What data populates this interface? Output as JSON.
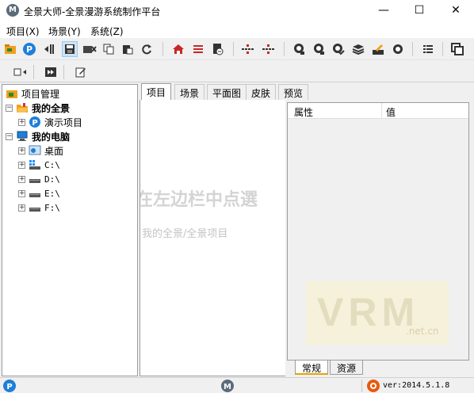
{
  "window": {
    "title": "全景大师-全景漫游系统制作平台",
    "app_icon_letter": "M",
    "controls": {
      "minimize": "—",
      "maximize": "☐",
      "close": "✕"
    }
  },
  "menu": {
    "items": [
      "项目(X)",
      "场景(Y)",
      "系统(Z)"
    ]
  },
  "toolbar1": {
    "icons": [
      "new-project-icon",
      "panorama-logo-icon",
      "import-icon",
      "save-icon",
      "delete-icon",
      "copy-icon",
      "paste-icon",
      "refresh-icon",
      "home-icon",
      "list-icon",
      "export-icon",
      "hotspot-icon",
      "hotspot2-icon",
      "camera-icon",
      "camera2-icon",
      "camera-check-icon",
      "layers-icon",
      "edit-map-icon",
      "record-icon",
      "menu-list-icon",
      "window-icon"
    ]
  },
  "toolbar2": {
    "icons": [
      "slide-icon",
      "film-icon",
      "edit-icon"
    ]
  },
  "tree": {
    "header": "项目管理",
    "my_panorama": "我的全景",
    "demo_project": "演示项目",
    "my_computer": "我的电脑",
    "desktop": "桌面",
    "drives": [
      "C:\\",
      "D:\\",
      "E:\\",
      "F:\\"
    ]
  },
  "tabs": [
    "项目",
    "场景",
    "平面图",
    "皮肤",
    "预览"
  ],
  "content": {
    "hint_line1": "在左边栏中点選",
    "hint_line2": "我的全景/全景项目"
  },
  "properties": {
    "col_property": "属性",
    "col_value": "值",
    "watermark_main": "VRM",
    "watermark_sub": ".net.cn",
    "subtabs": [
      "常规",
      "资源"
    ]
  },
  "status": {
    "version": "ver:2014.5.1.8"
  },
  "colors": {
    "accent": "#1e7fd8",
    "folder": "#f0a020",
    "tab_underline": "#e6a400"
  }
}
